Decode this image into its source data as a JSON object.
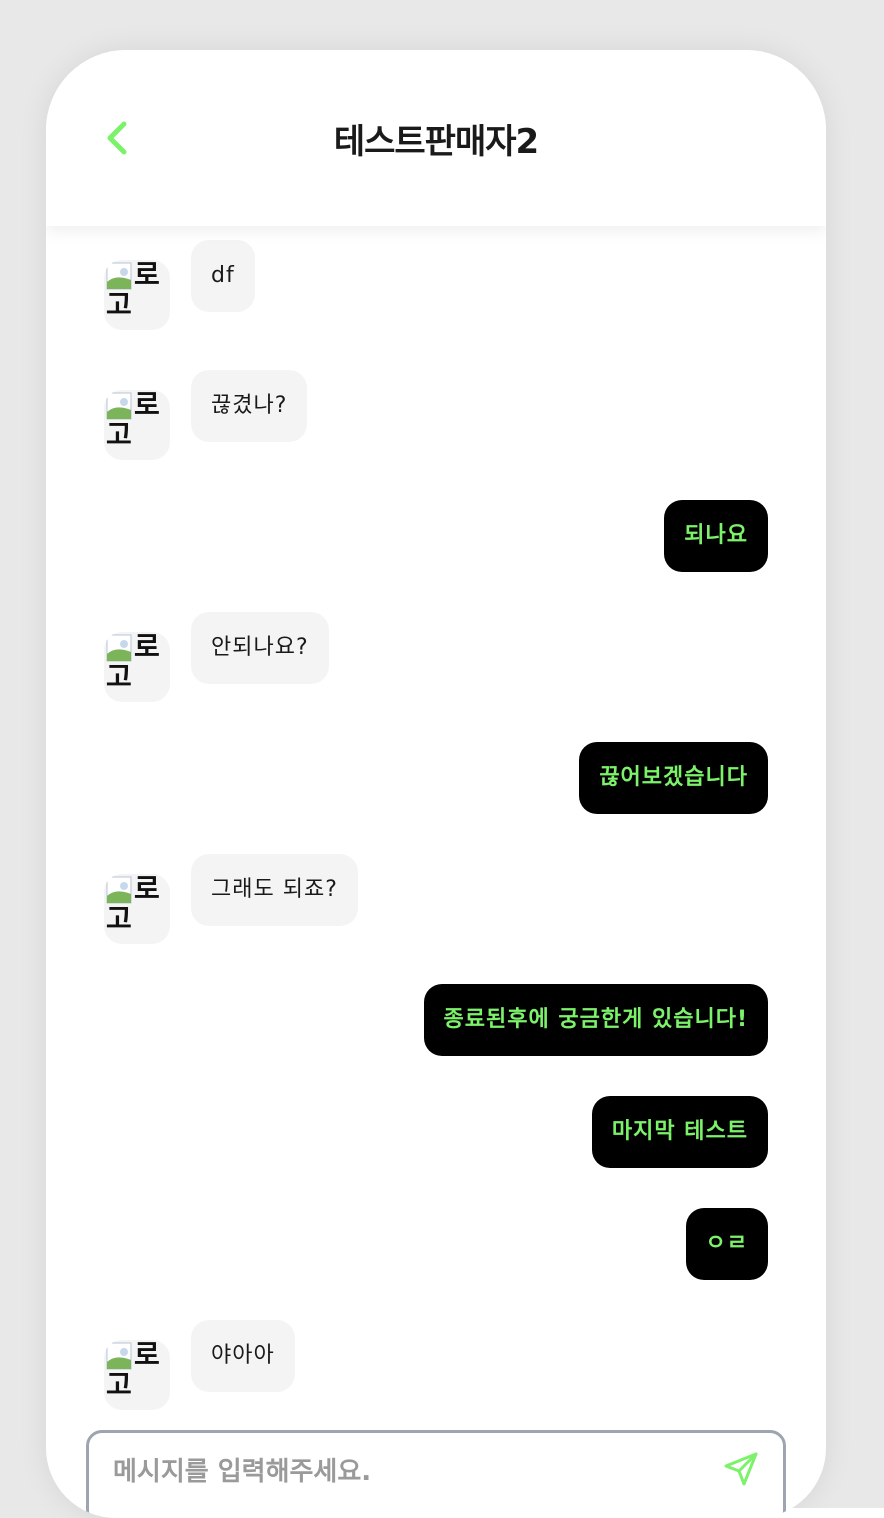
{
  "header": {
    "title": "테스트판매자2",
    "back_icon": "chevron-left-icon"
  },
  "colors": {
    "accent": "#7cf26a",
    "outgoing_bg": "#000000",
    "incoming_bg": "#f4f4f4",
    "input_border": "#9ea4b2"
  },
  "avatar": {
    "alt": "로고"
  },
  "messages": [
    {
      "from": "seller",
      "text": "df"
    },
    {
      "from": "seller",
      "text": "끊겼나?"
    },
    {
      "from": "me",
      "text": "되나요"
    },
    {
      "from": "seller",
      "text": "안되나요?"
    },
    {
      "from": "me",
      "text": "끊어보겠습니다"
    },
    {
      "from": "seller",
      "text": "그래도 되죠?"
    },
    {
      "from": "me",
      "text": "종료된후에 궁금한게 있습니다!"
    },
    {
      "from": "me",
      "text": "마지막 테스트"
    },
    {
      "from": "me",
      "text": "ㅇㄹ"
    },
    {
      "from": "seller",
      "text": "야아아"
    }
  ],
  "composer": {
    "placeholder": "메시지를 입력해주세요.",
    "send_icon": "send-icon"
  }
}
